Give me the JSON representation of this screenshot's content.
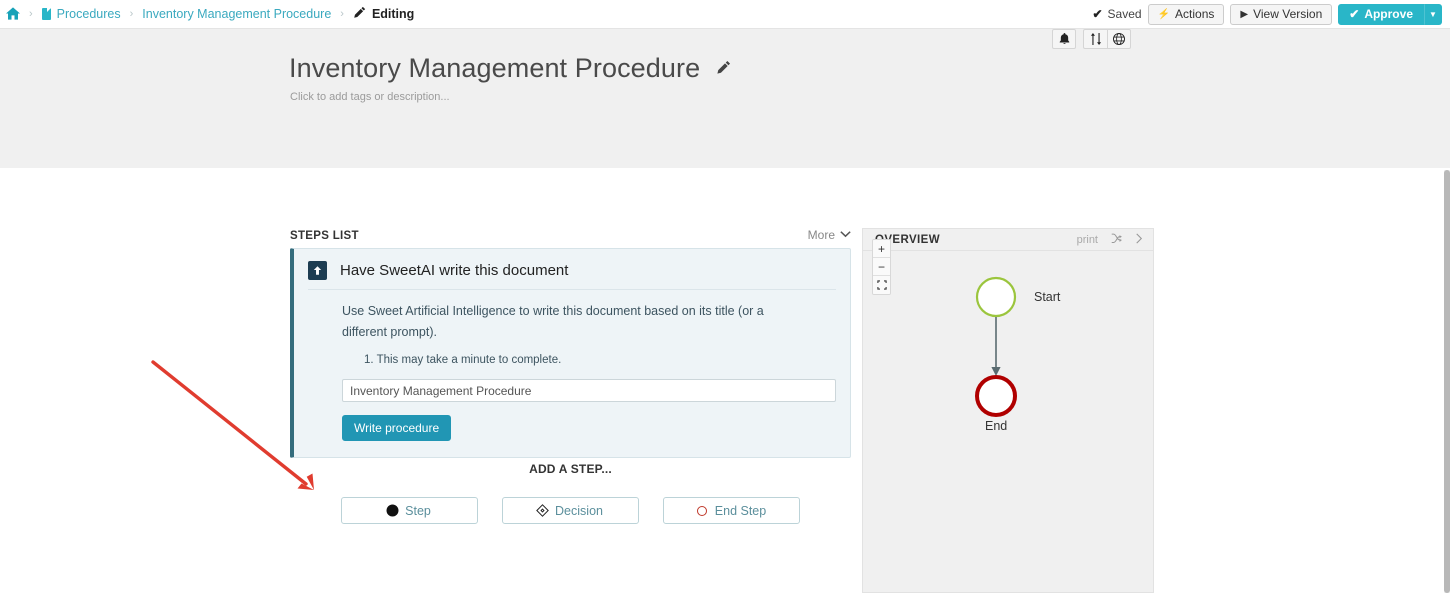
{
  "breadcrumb": {
    "home_icon": "home-icon",
    "items": [
      {
        "label": "Procedures",
        "icon": "none"
      },
      {
        "label": "Inventory Management Procedure",
        "icon": "document-icon"
      },
      {
        "label": "Editing",
        "icon": "pencil-icon"
      }
    ],
    "separator": "›"
  },
  "topbar": {
    "saved_label": "Saved",
    "saved_check": "✔",
    "actions_label": "Actions",
    "actions_icon": "⚡",
    "view_version_label": "View Version",
    "view_version_icon": "▶",
    "approve_label": "Approve",
    "approve_check": "✔",
    "approve_caret": "▼"
  },
  "header": {
    "title": "Inventory Management Procedure",
    "title_edit_icon": "pencil-icon",
    "subtitle": "Click to add tags or description...",
    "icon_buttons": [
      {
        "name": "notifications-bell-icon",
        "glyph": "🔔"
      },
      {
        "name": "sort-order-icon",
        "glyph": "⇅"
      },
      {
        "name": "globe-icon",
        "glyph": "🌐"
      }
    ]
  },
  "steps": {
    "panel_title": "STEPS LIST",
    "more_label": "More",
    "more_caret": "⌄",
    "card": {
      "icon": "arrow-up-box-icon",
      "icon_glyph": "⬆",
      "title": "Have SweetAI write this document",
      "description": "Use Sweet Artificial Intelligence to write this document based on its title (or a different prompt).",
      "note": "1. This may take a minute to complete.",
      "input_value": "Inventory Management Procedure",
      "input_placeholder": "Inventory Management Procedure",
      "button_label": "Write procedure"
    }
  },
  "add_step": {
    "label": "ADD A STEP...",
    "buttons": [
      {
        "label": "Step",
        "icon": "filled-circle-icon"
      },
      {
        "label": "Decision",
        "icon": "diamond-icon"
      },
      {
        "label": "End Step",
        "icon": "red-circle-outline-icon"
      }
    ]
  },
  "overview": {
    "panel_title": "OVERVIEW",
    "print_label": "print",
    "expand_icon": "shuffle-expand-icon",
    "collapse_icon": "chevron-right-icon",
    "zoom_in": "+",
    "zoom_out": "−",
    "fit_screen": "⛶",
    "nodes": [
      {
        "label": "Start",
        "type": "start",
        "color": "#9bc53d"
      },
      {
        "label": "End",
        "type": "end",
        "color": "#b00000"
      }
    ]
  },
  "annotation": {
    "type": "arrow",
    "color": "#e03c2f",
    "points_to": "Step"
  },
  "colors": {
    "accent": "#29b6c8",
    "card_border": "#356d7d",
    "card_bg": "#eef4f7",
    "banner_bg": "#f0f0f0",
    "start_node": "#9bc53d",
    "end_node": "#b00000"
  }
}
